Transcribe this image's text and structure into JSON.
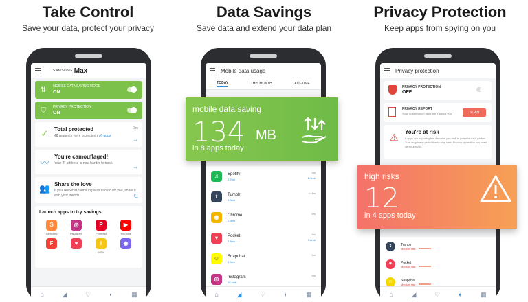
{
  "panels": [
    {
      "title": "Take Control",
      "subtitle": "Save your data, protect your privacy"
    },
    {
      "title": "Data Savings",
      "subtitle": "Save data and extend your data plan"
    },
    {
      "title": "Privacy Protection",
      "subtitle": "Keep apps from spying on you"
    }
  ],
  "phone1": {
    "brand_small": "SAMSUNG",
    "brand_big": "Max",
    "cards": [
      {
        "title": "MOBILE DATA SAVING MODE",
        "status": "ON",
        "icon": "data-saving-icon"
      },
      {
        "title": "PRIVACY PROTECTION",
        "status": "ON",
        "icon": "shield-icon"
      }
    ],
    "total": {
      "title": "Total protected",
      "sub_count": "40",
      "sub_text": "requests were protected in",
      "sub_apps": "6 apps",
      "time": "3m"
    },
    "camouflaged": {
      "title": "You're camouflaged!",
      "sub": "Your IP address is now harder to track."
    },
    "share": {
      "title": "Share the love",
      "sub": "If you like what Samsung Max can do for you, share it with your friends."
    },
    "apps_title": "Launch apps to try savings",
    "apps": [
      {
        "name": "Samsung",
        "color": "#ff8a3d",
        "glyph": "S"
      },
      {
        "name": "Instagram",
        "color": "#c13584",
        "glyph": "◎"
      },
      {
        "name": "Pinterest",
        "color": "#e60023",
        "glyph": "P"
      },
      {
        "name": "YouTube",
        "color": "#ff0000",
        "glyph": "▶"
      },
      {
        "name": "",
        "color": "#ef4135",
        "glyph": "F"
      },
      {
        "name": "",
        "color": "#ef4056",
        "glyph": "♥"
      },
      {
        "name": "IMDb",
        "color": "#f5c518",
        "glyph": "i"
      },
      {
        "name": "",
        "color": "#7b68ee",
        "glyph": "◉"
      }
    ]
  },
  "phone2": {
    "title": "Mobile data usage",
    "tabs": [
      "TODAY",
      "THIS MONTH",
      "ALL-TIME"
    ],
    "rows": [
      {
        "name": "Spotify",
        "saved": "2.7mb",
        "right1": "5m",
        "right2": "6.3mb",
        "color": "#1db954",
        "glyph": "♫"
      },
      {
        "name": "Tumblr",
        "saved": "5.9mb",
        "right1": "+14m",
        "right2": "",
        "color": "#35465c",
        "glyph": "t"
      },
      {
        "name": "Chrome",
        "saved": "2.5mb",
        "right1": "5m",
        "right2": "",
        "color": "#f4b400",
        "glyph": "◉"
      },
      {
        "name": "Pocket",
        "saved": "2.8mb",
        "right1": "5m",
        "right2": "3.8mb",
        "color": "#ef4056",
        "glyph": "♥"
      },
      {
        "name": "Snapchat",
        "saved": "1.9mb",
        "right1": "5m",
        "right2": "",
        "color": "#fffc00",
        "glyph": "☺"
      },
      {
        "name": "Instagram",
        "saved": "16.4mb",
        "right1": "5m",
        "right2": "",
        "color": "#c13584",
        "glyph": "◎"
      }
    ],
    "overlay": {
      "label": "mobile data saving",
      "value": "134",
      "unit": "MB",
      "foot": "in 8 apps today"
    }
  },
  "phone3": {
    "title": "Privacy protection",
    "prot_title": "PRIVACY PROTECTION",
    "prot_status": "OFF",
    "report_title": "PRIVACY REPORT",
    "report_sub": "Scan to see which apps are tracking you",
    "scan_label": "SCAN",
    "risk_title": "You're at risk",
    "risk_sub": "8 apps are exposing the domains you visit to potential third parties. Turn on privacy protection to stay safe. Privacy protection has been off for 4m 25s.",
    "rows": [
      {
        "name": "Tumblr",
        "risk": "Medium risk",
        "color": "#35465c",
        "glyph": "t"
      },
      {
        "name": "Pocket",
        "risk": "Medium risk",
        "color": "#ef4056",
        "glyph": "♥"
      },
      {
        "name": "Snapchat",
        "risk": "Medium risk",
        "color": "#f5d800",
        "glyph": "☺"
      }
    ],
    "overlay": {
      "label": "high risks",
      "value": "12",
      "foot": "in 4 apps today"
    }
  },
  "colors": {
    "green": "#7cc24a",
    "red": "#f4726a",
    "orange": "#f6a055",
    "blue": "#2c8fe0"
  }
}
